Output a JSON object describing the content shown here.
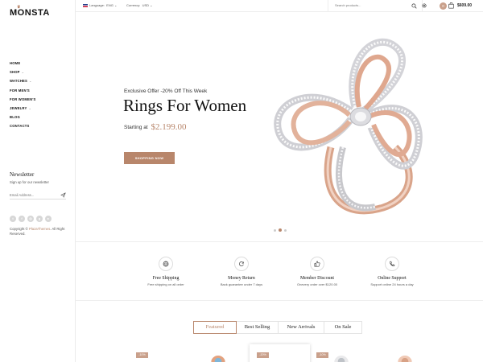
{
  "brand": {
    "logo_text": "MONSTA"
  },
  "sidebar": {
    "nav": [
      {
        "label": "HOME",
        "has_submenu": false
      },
      {
        "label": "SHOP",
        "has_submenu": true
      },
      {
        "label": "WATCHES",
        "has_submenu": true
      },
      {
        "label": "FOR MEN'S",
        "has_submenu": false
      },
      {
        "label": "FOR WOMEN'S",
        "has_submenu": false
      },
      {
        "label": "JEWELRY",
        "has_submenu": true
      },
      {
        "label": "BLOG",
        "has_submenu": false
      },
      {
        "label": "CONTACTS",
        "has_submenu": false
      }
    ],
    "newsletter": {
      "title": "Newsletter",
      "subtitle": "Sign up  for our newsletter",
      "placeholder": "Email Address..."
    },
    "socials": [
      "twitter-icon",
      "facebook-icon",
      "instagram-icon",
      "google-plus-icon",
      "youtube-icon"
    ],
    "copyright_prefix": "Copyright ©",
    "copyright_brand": "PlazaThemes",
    "copyright_suffix": ". All Right Reserved."
  },
  "topbar": {
    "language_label": "Language:",
    "language_value": "ENG",
    "currency_label": "Currency:",
    "currency_value": "USD",
    "search_placeholder": "Search products...",
    "user_initial": "0",
    "cart_total": "$609.00"
  },
  "hero": {
    "offer": "Exclusive Offer -20% Off This Week",
    "title": "Rings For Women",
    "starting_label": "Starting at",
    "price": "$2.199.00",
    "button_label": "SHOPPING NOW",
    "slides": 3,
    "active_slide": 2
  },
  "features": [
    {
      "icon": "globe-icon",
      "title": "Free Shipping",
      "subtitle": "Free shipping on all order"
    },
    {
      "icon": "refresh-icon",
      "title": "Money Return",
      "subtitle": "Back guarantee under 7 days"
    },
    {
      "icon": "thumbs-up-icon",
      "title": "Member Discount",
      "subtitle": "Onevery order over $120.00"
    },
    {
      "icon": "phone-icon",
      "title": "Online Support",
      "subtitle": "Support online 24 hours a day"
    }
  ],
  "product_tabs": [
    {
      "label": "Featured",
      "active": true
    },
    {
      "label": "Best Selling",
      "active": false
    },
    {
      "label": "New Arrivals",
      "active": false
    },
    {
      "label": "On Sale",
      "active": false
    }
  ],
  "product_badges": [
    "-10%",
    "-20%",
    "-10%"
  ],
  "colors": {
    "accent": "#b8866b",
    "text": "#111111",
    "muted": "#555555",
    "border": "#eeeeee"
  }
}
